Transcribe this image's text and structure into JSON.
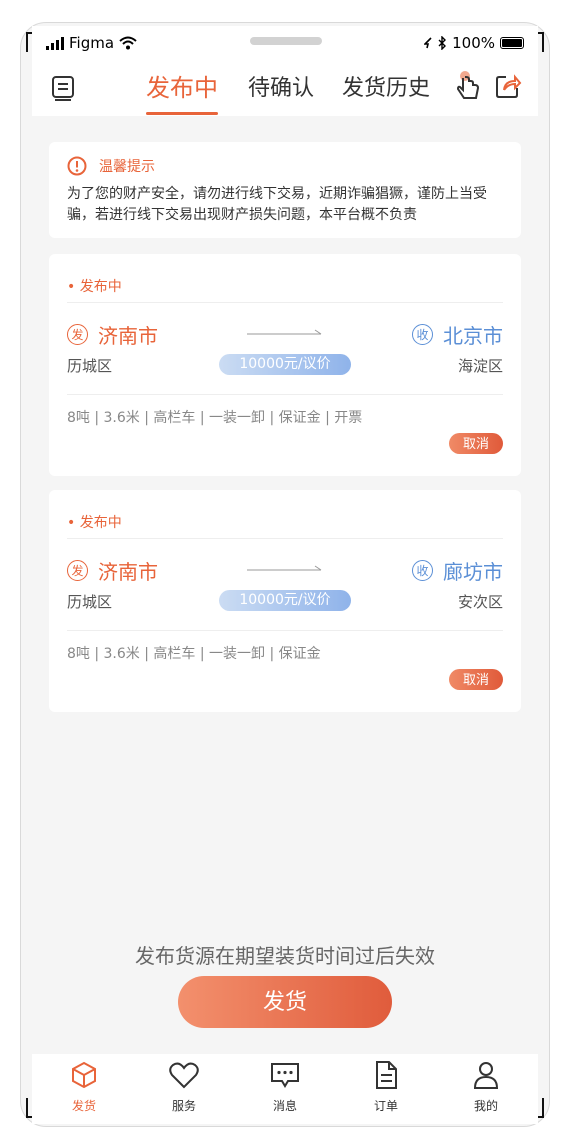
{
  "status_bar": {
    "carrier": "Figma",
    "battery": "100%"
  },
  "tabs": [
    {
      "label": "发布中",
      "active": true
    },
    {
      "label": "待确认",
      "active": false
    },
    {
      "label": "发货历史",
      "active": false
    }
  ],
  "header_icons": {
    "left": "message-list-icon",
    "right1": "hand-pointer-icon",
    "right2": "share-icon"
  },
  "tip": {
    "title": "温馨提示",
    "body": "为了您的财产安全，请勿进行线下交易，近期诈骗猖獗，谨防上当受骗，若进行线下交易出现财产损失问题，本平台概不负责"
  },
  "orders": [
    {
      "status": "• 发布中",
      "from_badge": "发",
      "from_city": "济南市",
      "from_district": "历城区",
      "to_badge": "收",
      "to_city": "北京市",
      "to_district": "海淀区",
      "price": "10000元/议价",
      "specs": "8吨 | 3.6米 | 高栏车 | 一装一卸 | 保证金 | 开票",
      "cancel_label": "取消"
    },
    {
      "status": "• 发布中",
      "from_badge": "发",
      "from_city": "济南市",
      "from_district": "历城区",
      "to_badge": "收",
      "to_city": "廊坊市",
      "to_district": "安次区",
      "price": "10000元/议价",
      "specs": "8吨 | 3.6米 | 高栏车 | 一装一卸 | 保证金",
      "cancel_label": "取消"
    }
  ],
  "expire_note": "发布货源在期望装货时间过后失效",
  "ship_button": "发货",
  "bottom_nav": [
    {
      "label": "发货",
      "icon": "cube-icon",
      "active": true
    },
    {
      "label": "服务",
      "icon": "heart-icon",
      "active": false
    },
    {
      "label": "消息",
      "icon": "chat-icon",
      "active": false
    },
    {
      "label": "订单",
      "icon": "document-icon",
      "active": false
    },
    {
      "label": "我的",
      "icon": "user-icon",
      "active": false
    }
  ],
  "colors": {
    "accent": "#e8643a",
    "blue": "#5b8fd6",
    "background": "#f5f5f5"
  }
}
